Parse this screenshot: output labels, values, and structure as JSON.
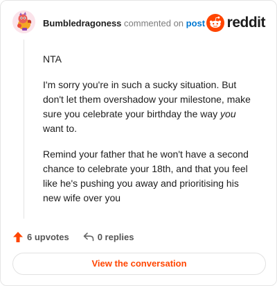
{
  "header": {
    "username": "Bumbledragoness",
    "verb": "commented on",
    "post_link": "post",
    "brand": "reddit"
  },
  "comment": {
    "paragraphs": [
      "NTA",
      "I'm sorry you're in such a sucky situation. But don't let them overshadow your milestone, make sure you celebrate your birthday the way",
      "Remind your father that he won't have a second chance to celebrate your 18th, and that you feel like he's pushing you away and prioritising his new wife over you"
    ],
    "emphasis": "you",
    "after_emphasis": "want to."
  },
  "actions": {
    "upvotes": "6 upvotes",
    "replies": "0 replies"
  },
  "cta": {
    "label": "View the conversation"
  },
  "colors": {
    "accent": "#ff4500",
    "link": "#0079d3"
  },
  "icons": [
    "avatar-icon",
    "reddit-logo-icon",
    "upvote-arrow-icon",
    "reply-icon"
  ]
}
